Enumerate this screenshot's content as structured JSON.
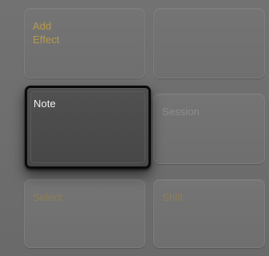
{
  "pads": {
    "add_effect": {
      "label": "Add\nEffect"
    },
    "empty": {
      "label": ""
    },
    "note": {
      "label": "Note",
      "active": true
    },
    "session": {
      "label": "Session"
    },
    "select": {
      "label": "Select"
    },
    "shift": {
      "label": "Shift"
    }
  },
  "colors": {
    "panel": "#6f6f6f",
    "pad_face": "#727272",
    "label_amber": "#b79a4a",
    "label_gray": "#8c8c8c",
    "active_face": "#4b4b4b",
    "active_border": "#0b0b0b",
    "active_label": "#f2f2f2"
  }
}
